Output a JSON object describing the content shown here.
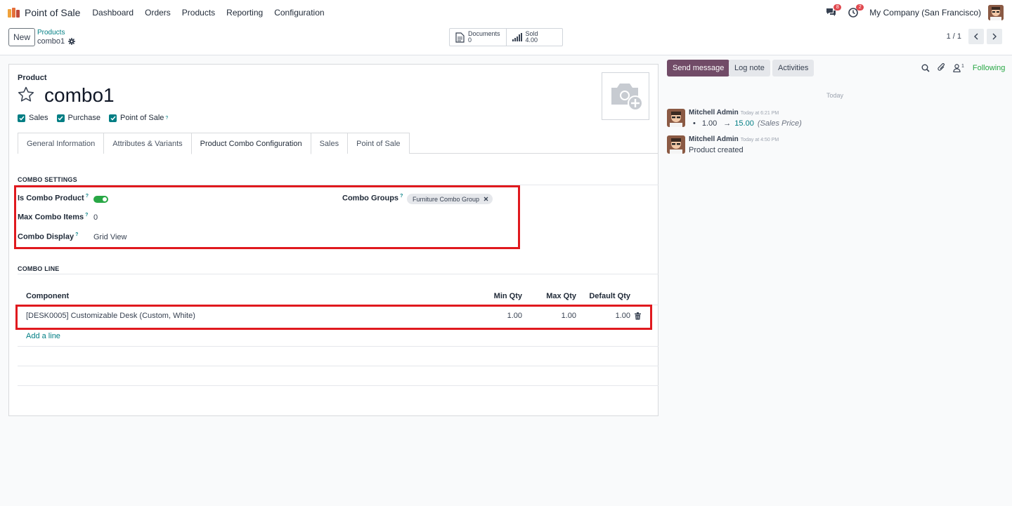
{
  "nav": {
    "app_name": "Point of Sale",
    "menu": [
      "Dashboard",
      "Orders",
      "Products",
      "Reporting",
      "Configuration"
    ],
    "messages_badge": "8",
    "activities_badge": "2",
    "company": "My Company (San Francisco)"
  },
  "control": {
    "new_label": "New",
    "breadcrumb_parent": "Products",
    "breadcrumb_current": "combo1",
    "smart_buttons": [
      {
        "label": "Documents",
        "value": "0"
      },
      {
        "label": "Sold",
        "value": "4.00"
      }
    ],
    "pager": "1 / 1"
  },
  "form": {
    "product_label": "Product",
    "name": "combo1",
    "checkboxes": [
      {
        "label": "Sales",
        "checked": true
      },
      {
        "label": "Purchase",
        "checked": true
      },
      {
        "label": "Point of Sale",
        "checked": true,
        "tooltip": "?"
      }
    ],
    "tabs": [
      "General Information",
      "Attributes & Variants",
      "Product Combo Configuration",
      "Sales",
      "Point of Sale"
    ],
    "active_tab": "Product Combo Configuration",
    "combo_settings": {
      "title": "COMBO SETTINGS",
      "is_combo_label": "Is Combo Product",
      "is_combo_value": true,
      "max_items_label": "Max Combo Items",
      "max_items_value": "0",
      "display_label": "Combo Display",
      "display_value": "Grid View",
      "groups_label": "Combo Groups",
      "groups_tags": [
        "Furniture Combo Group"
      ],
      "tooltip": "?"
    },
    "combo_line": {
      "title": "COMBO LINE",
      "columns": [
        "Component",
        "Min Qty",
        "Max Qty",
        "Default Qty"
      ],
      "rows": [
        {
          "component": "[DESK0005] Customizable Desk (Custom, White)",
          "min": "1.00",
          "max": "1.00",
          "default": "1.00"
        }
      ],
      "add_line": "Add a line"
    }
  },
  "chatter": {
    "send_message": "Send message",
    "log_note": "Log note",
    "activities": "Activities",
    "followers_count": "1",
    "following": "Following",
    "date_separator": "Today",
    "messages": [
      {
        "author": "Mitchell Admin",
        "time": "Today at 6:21 PM",
        "old_value": "1.00",
        "arrow": "→",
        "new_value": "15.00",
        "field": "(Sales Price)"
      },
      {
        "author": "Mitchell Admin",
        "time": "Today at 4:50 PM",
        "body": "Product created"
      }
    ]
  },
  "colors": {
    "accent": "#017e84",
    "primary": "#714b67",
    "highlight": "#e0191e",
    "toggle_on": "#28a745"
  }
}
